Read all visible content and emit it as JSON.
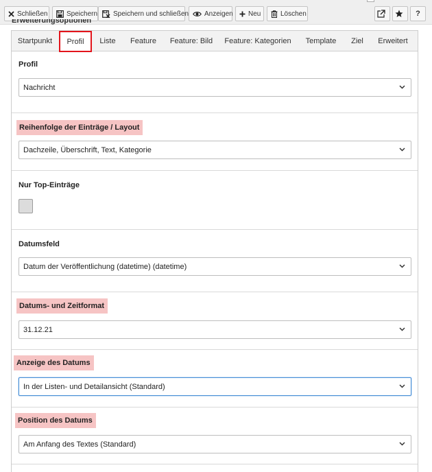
{
  "toolbar": {
    "close_label": "Schließen",
    "save_label": "Speichern",
    "save_close_label": "Speichern und schließen",
    "view_label": "Anzeigen",
    "new_label": "Neu",
    "delete_label": "Löschen",
    "help_label": "?",
    "icons": [
      "close-icon",
      "save-icon",
      "save-close-icon",
      "eye-icon",
      "plus-icon",
      "trash-icon",
      "external-link-icon",
      "star-icon"
    ]
  },
  "section": {
    "title": "Erweiterungsoptionen"
  },
  "tabs": [
    {
      "label": "Startpunkt"
    },
    {
      "label": "Profil",
      "active": true
    },
    {
      "label": "Liste"
    },
    {
      "label": "Feature"
    },
    {
      "label": "Feature: Bild"
    },
    {
      "label": "Feature: Kategorien"
    },
    {
      "label": "Template"
    },
    {
      "label": "Ziel"
    },
    {
      "label": "Erweitert"
    }
  ],
  "fields": {
    "profile": {
      "label": "Profil",
      "value": "Nachricht"
    },
    "order": {
      "label": "Reihenfolge der Einträge / Layout",
      "value": "Dachzeile, Überschrift, Text, Kategorie"
    },
    "top_entries": {
      "label": "Nur Top-Einträge",
      "checked": false
    },
    "date_field": {
      "label": "Datumsfeld",
      "value": "Datum der Veröffentlichung (datetime) (datetime)"
    },
    "date_format": {
      "label": "Datums- und Zeitformat",
      "value": "31.12.21"
    },
    "date_display": {
      "label": "Anzeige des Datums",
      "value": "In der Listen- und Detailansicht (Standard)"
    },
    "date_position": {
      "label": "Position des Datums",
      "value": "Am Anfang des Textes (Standard)"
    }
  },
  "colors": {
    "active_tab_border": "#e3141b",
    "highlight": "#f6c4c4",
    "focus_border": "#4a90d6"
  }
}
